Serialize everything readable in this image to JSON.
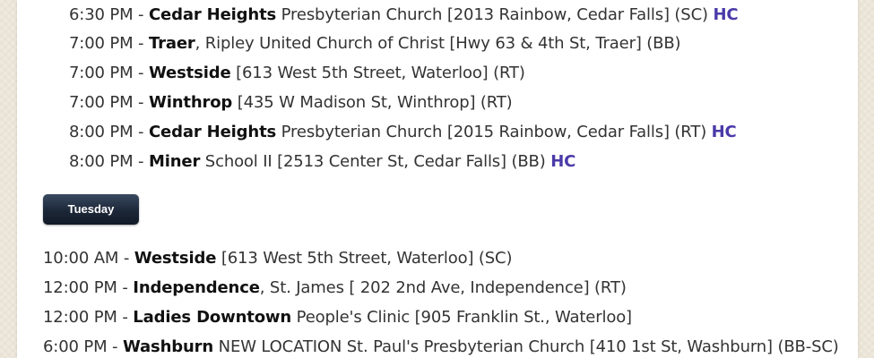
{
  "schedule": {
    "monday_tail": [
      {
        "time": "6:30 PM",
        "sep": " - ",
        "name": "Cedar Heights",
        "detail": " Presbyterian Church [2013 Rainbow, Cedar Falls] (SC) ",
        "badge": "HC"
      },
      {
        "time": "7:00 PM",
        "sep": " - ",
        "name": "Traer",
        "detail": ", Ripley United Church of Christ [Hwy 63 & 4th St, Traer] (BB)",
        "badge": ""
      },
      {
        "time": "7:00 PM",
        "sep": " - ",
        "name": "Westside",
        "detail": " [613 West 5th Street, Waterloo] (RT)",
        "badge": ""
      },
      {
        "time": "7:00 PM",
        "sep": " - ",
        "name": "Winthrop",
        "detail": " [435 W Madison St, Winthrop] (RT)",
        "badge": ""
      },
      {
        "time": "8:00 PM",
        "sep": " - ",
        "name": "Cedar Heights",
        "detail": " Presbyterian Church [2015 Rainbow, Cedar Falls] (RT) ",
        "badge": "HC"
      },
      {
        "time": "8:00 PM",
        "sep": " - ",
        "name": "Miner",
        "detail": " School II [2513 Center St, Cedar Falls] (BB) ",
        "badge": "HC"
      }
    ],
    "day_button": {
      "label": "Tuesday"
    },
    "tuesday": [
      {
        "time": "10:00 AM",
        "sep": " - ",
        "name": "Westside",
        "detail": " [613 West 5th Street, Waterloo] (SC)"
      },
      {
        "time": "12:00 PM",
        "sep": " - ",
        "name": "Independence",
        "detail": ", St. James [ 202 2nd Ave, Independence] (RT)"
      },
      {
        "time": "12:00 PM",
        "sep": " - ",
        "name": "Ladies Downtown",
        "detail": " People's Clinic [905 Franklin St., Waterloo]"
      },
      {
        "time": "6:00 PM",
        "sep": " - ",
        "name": "Washburn",
        "detail": " NEW LOCATION St. Paul's Presbyterian Church [410 1st St, Washburn] (BB-SC)"
      }
    ]
  },
  "colors": {
    "page_background": "#ece6d8",
    "panel": "#ffffff",
    "text": "#333333",
    "hc_link": "#4a3aa8",
    "button": "#1c2738"
  }
}
